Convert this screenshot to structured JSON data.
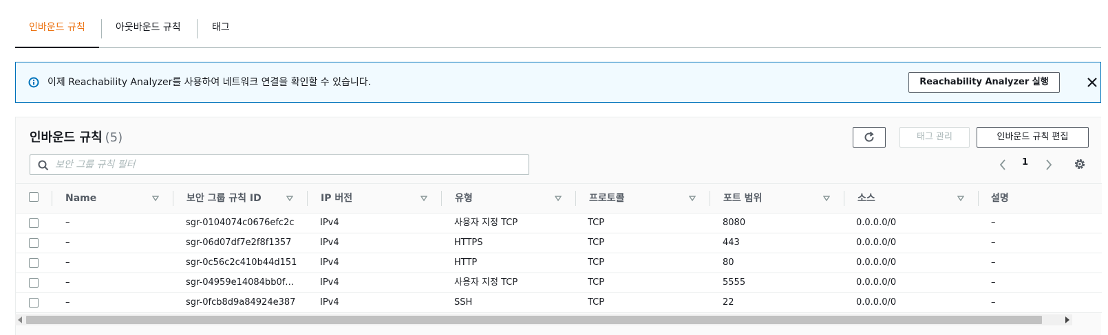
{
  "tabs": [
    {
      "label": "인바운드 규칙",
      "active": true
    },
    {
      "label": "아웃바운드 규칙",
      "active": false
    },
    {
      "label": "태그",
      "active": false
    }
  ],
  "flash": {
    "icon": "info-icon",
    "text": "이제 Reachability Analyzer를 사용하여 네트워크 연결을 확인할 수 있습니다.",
    "button_label": "Reachability Analyzer 실행",
    "close_icon": "close-icon"
  },
  "panel": {
    "title": "인바운드 규칙",
    "count": "(5)",
    "refresh_icon": "refresh-icon",
    "manage_tags_label": "태그 관리",
    "edit_inbound_label": "인바운드 규칙 편집"
  },
  "search": {
    "placeholder": "보안 그룹 규칙 필터"
  },
  "pagination": {
    "current_page": "1"
  },
  "table": {
    "columns": [
      "Name",
      "보안 그룹 규칙 ID",
      "IP 버전",
      "유형",
      "프로토콜",
      "포트 범위",
      "소스",
      "설명"
    ],
    "rows": [
      {
        "name": "–",
        "rule_id": "sgr-0104074c0676efc2c",
        "ip_version": "IPv4",
        "type": "사용자 지정 TCP",
        "protocol": "TCP",
        "port_range": "8080",
        "source": "0.0.0.0/0",
        "description": "–"
      },
      {
        "name": "–",
        "rule_id": "sgr-06d07df7e2f8f1357",
        "ip_version": "IPv4",
        "type": "HTTPS",
        "protocol": "TCP",
        "port_range": "443",
        "source": "0.0.0.0/0",
        "description": "–"
      },
      {
        "name": "–",
        "rule_id": "sgr-0c56c2c410b44d151",
        "ip_version": "IPv4",
        "type": "HTTP",
        "protocol": "TCP",
        "port_range": "80",
        "source": "0.0.0.0/0",
        "description": "–"
      },
      {
        "name": "–",
        "rule_id": "sgr-04959e14084bb0f…",
        "ip_version": "IPv4",
        "type": "사용자 지정 TCP",
        "protocol": "TCP",
        "port_range": "5555",
        "source": "0.0.0.0/0",
        "description": "–"
      },
      {
        "name": "–",
        "rule_id": "sgr-0fcb8d9a84924e387",
        "ip_version": "IPv4",
        "type": "SSH",
        "protocol": "TCP",
        "port_range": "22",
        "source": "0.0.0.0/0",
        "description": "–"
      }
    ]
  },
  "colors": {
    "accent": "#ec7211",
    "info_border": "#0073bb",
    "info_bg": "#f1faff"
  }
}
